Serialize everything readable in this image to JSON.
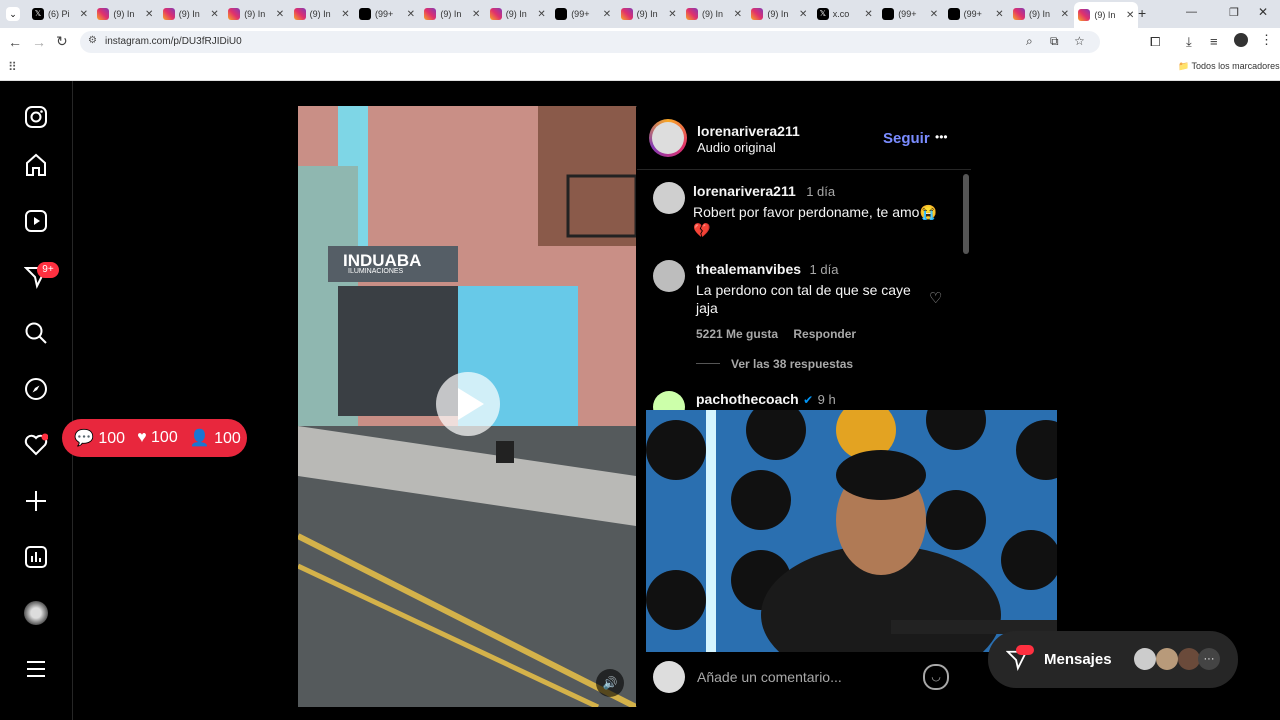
{
  "browser": {
    "tabs": [
      {
        "type": "x",
        "label": "(6) Pi"
      },
      {
        "type": "ig",
        "label": "(9) In"
      },
      {
        "type": "ig",
        "label": "(9) In"
      },
      {
        "type": "ig",
        "label": "(9) In"
      },
      {
        "type": "ig",
        "label": "(9) In"
      },
      {
        "type": "tt",
        "label": "(99+"
      },
      {
        "type": "ig",
        "label": "(9) In"
      },
      {
        "type": "ig",
        "label": "(9) In"
      },
      {
        "type": "tt",
        "label": "(99+"
      },
      {
        "type": "ig",
        "label": "(9) In"
      },
      {
        "type": "ig",
        "label": "(9) In"
      },
      {
        "type": "ig",
        "label": "(9) In"
      },
      {
        "type": "x",
        "label": "x.co"
      },
      {
        "type": "tt",
        "label": "(99+"
      },
      {
        "type": "tt",
        "label": "(99+"
      },
      {
        "type": "ig",
        "label": "(9) In"
      },
      {
        "type": "ig",
        "label": "(9) In"
      }
    ],
    "url": "instagram.com/p/DU3fRJIDiU0",
    "bookmarks_label": "Todos los marcadores"
  },
  "sidebar": {
    "notification_badge": "9+"
  },
  "stats": {
    "comments": "100",
    "likes": "100",
    "followers": "100"
  },
  "post": {
    "video_sign": "INDUABA",
    "video_sign_sub": "ILUMINACIONES"
  },
  "panel": {
    "author": "lorenarivera211",
    "subtitle": "Audio original",
    "follow_label": "Seguir",
    "more": "•••",
    "caption": {
      "user": "lorenarivera211",
      "time": "1 día",
      "text": "Robert por favor perdoname, te amo😭",
      "emoji2": "💔"
    },
    "comments": [
      {
        "user": "thealemanvibes",
        "time": "1 día",
        "text": "La perdono con tal de que se caye jaja",
        "likes": "5221 Me gusta",
        "reply": "Responder",
        "view_replies": "Ver las 38 respuestas"
      },
      {
        "user": "pachothecoach",
        "time": "9 h",
        "verified": true
      }
    ],
    "comment_placeholder": "Añade un comentario..."
  },
  "messages": {
    "label": "Mensajes",
    "badge": "",
    "more": "···"
  },
  "colors": {
    "accent": "#0095f6",
    "follow": "#7a8cff",
    "badge": "#ff3040",
    "pill": "#e8273d"
  }
}
